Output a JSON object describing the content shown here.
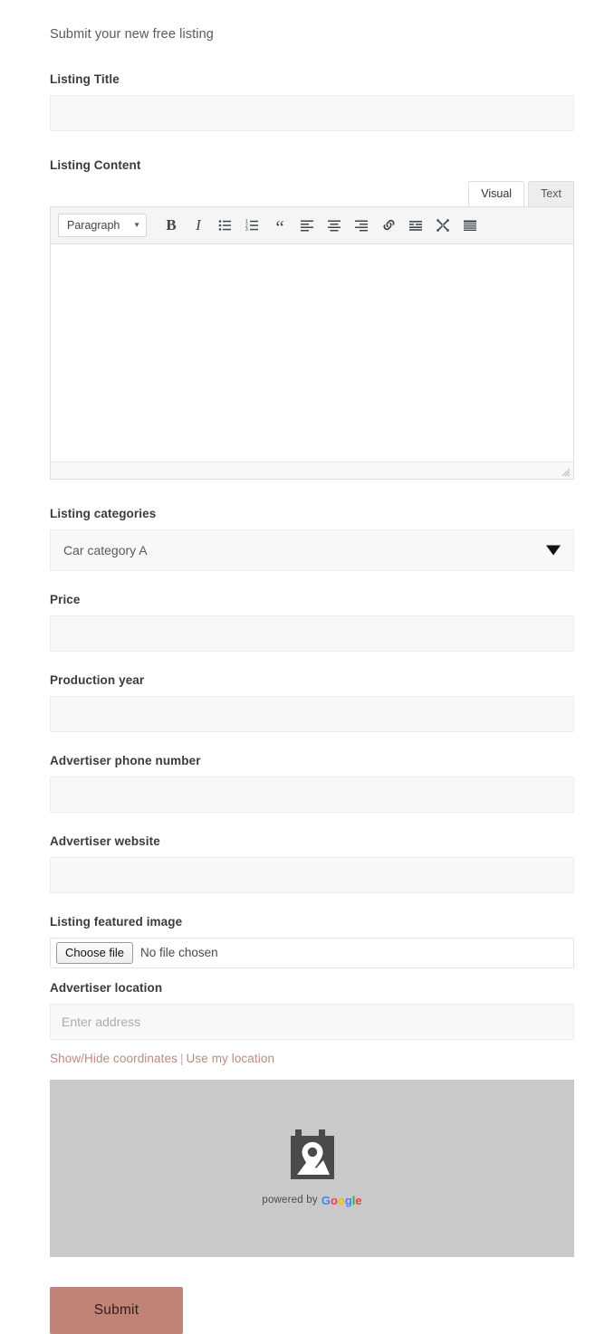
{
  "form": {
    "intro": "Submit your new free listing",
    "fields": {
      "title_label": "Listing Title",
      "title_value": "",
      "content_label": "Listing Content",
      "categories_label": "Listing categories",
      "categories_value": "Car category A",
      "price_label": "Price",
      "price_value": "",
      "year_label": "Production year",
      "year_value": "",
      "phone_label": "Advertiser phone number",
      "phone_value": "",
      "website_label": "Advertiser website",
      "website_value": "",
      "image_label": "Listing featured image",
      "location_label": "Advertiser location",
      "location_placeholder": "Enter address",
      "location_value": ""
    },
    "editor": {
      "tab_visual": "Visual",
      "tab_text": "Text",
      "format_select": "Paragraph",
      "body_text": "",
      "toolbar": [
        {
          "name": "bold-icon",
          "label": "B"
        },
        {
          "name": "italic-icon",
          "label": "I"
        },
        {
          "name": "bulleted-list-icon",
          "label": ""
        },
        {
          "name": "numbered-list-icon",
          "label": ""
        },
        {
          "name": "blockquote-icon",
          "label": "“"
        },
        {
          "name": "align-left-icon",
          "label": ""
        },
        {
          "name": "align-center-icon",
          "label": ""
        },
        {
          "name": "align-right-icon",
          "label": ""
        },
        {
          "name": "link-icon",
          "label": ""
        },
        {
          "name": "read-more-icon",
          "label": ""
        },
        {
          "name": "fullscreen-icon",
          "label": ""
        },
        {
          "name": "toolbar-toggle-icon",
          "label": ""
        }
      ]
    },
    "file_upload": {
      "button_label": "Choose file",
      "status_text": "No file chosen"
    },
    "location_actions": {
      "show_hide": "Show/Hide coordinates",
      "separator": "|",
      "use_my_location": "Use my location"
    },
    "map": {
      "credit_prefix": "powered by",
      "brand": "Google",
      "brand_letters": [
        "G",
        "o",
        "o",
        "g",
        "l",
        "e"
      ]
    },
    "submit_label": "Submit",
    "colors": {
      "accent": "#c08376",
      "link": "#bc8a80",
      "field_bg": "#f8f8f8",
      "map_bg": "#c9c9c9"
    }
  }
}
